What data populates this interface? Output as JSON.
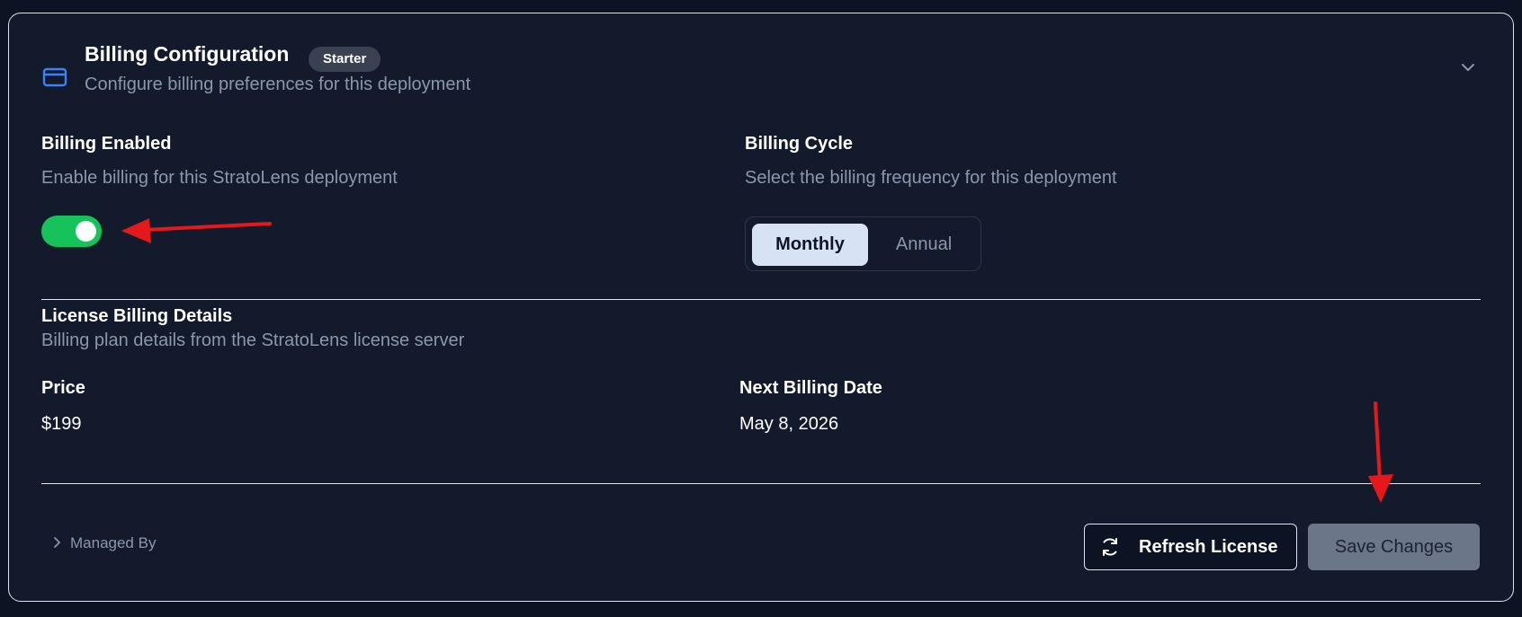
{
  "header": {
    "title": "Billing Configuration",
    "badge": "Starter",
    "subtitle": "Configure billing preferences for this deployment",
    "icon": "credit-card-icon",
    "collapse_icon": "chevron-down-icon"
  },
  "billing_enabled": {
    "label": "Billing Enabled",
    "description": "Enable billing for this StratoLens deployment",
    "enabled": true
  },
  "billing_cycle": {
    "label": "Billing Cycle",
    "description": "Select the billing frequency for this deployment",
    "options": [
      "Monthly",
      "Annual"
    ],
    "selected": "Monthly"
  },
  "license_details": {
    "title": "License Billing Details",
    "description": "Billing plan details from the StratoLens license server",
    "price_label": "Price",
    "price_value": "$199",
    "next_billing_label": "Next Billing Date",
    "next_billing_value": "May 8, 2026"
  },
  "footer": {
    "managed_by": "Managed By",
    "refresh_label": "Refresh License",
    "save_label": "Save Changes"
  },
  "colors": {
    "background": "#0c1322",
    "card": "#131a2b",
    "accent_blue": "#3b82f6",
    "toggle_on": "#16c25a",
    "annotation_arrow": "#e5191c"
  }
}
